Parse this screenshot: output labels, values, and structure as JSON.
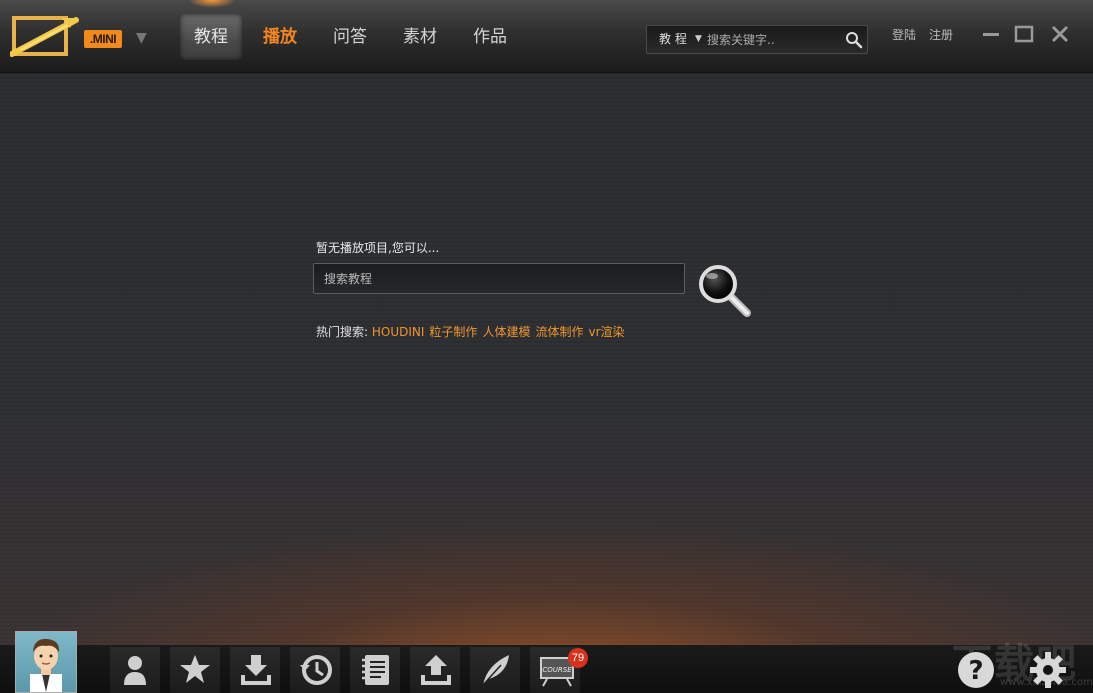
{
  "header": {
    "edition_badge": ".MINI",
    "tabs": [
      {
        "label": "教程",
        "state": "selected"
      },
      {
        "label": "播放",
        "state": "active"
      },
      {
        "label": "问答"
      },
      {
        "label": "素材"
      },
      {
        "label": "作品"
      }
    ],
    "search": {
      "category": "教 程",
      "placeholder": "搜索关键字.."
    },
    "login_label": "登陆",
    "register_label": "注册"
  },
  "main": {
    "empty_message": "暂无播放项目,您可以...",
    "search_placeholder": "搜索教程",
    "hot_search_label": "热门搜索:",
    "hot_search_items": [
      "HOUDINI",
      "粒子制作",
      "人体建模",
      "流体制作",
      "vr渲染"
    ]
  },
  "bottombar": {
    "course_badge_count": "79",
    "watermark": "下载吧",
    "watermark_url": "www.xiazaiba.com"
  },
  "colors": {
    "accent": "#f5861f",
    "hot_link": "#f0962d",
    "badge": "#d8321c"
  }
}
